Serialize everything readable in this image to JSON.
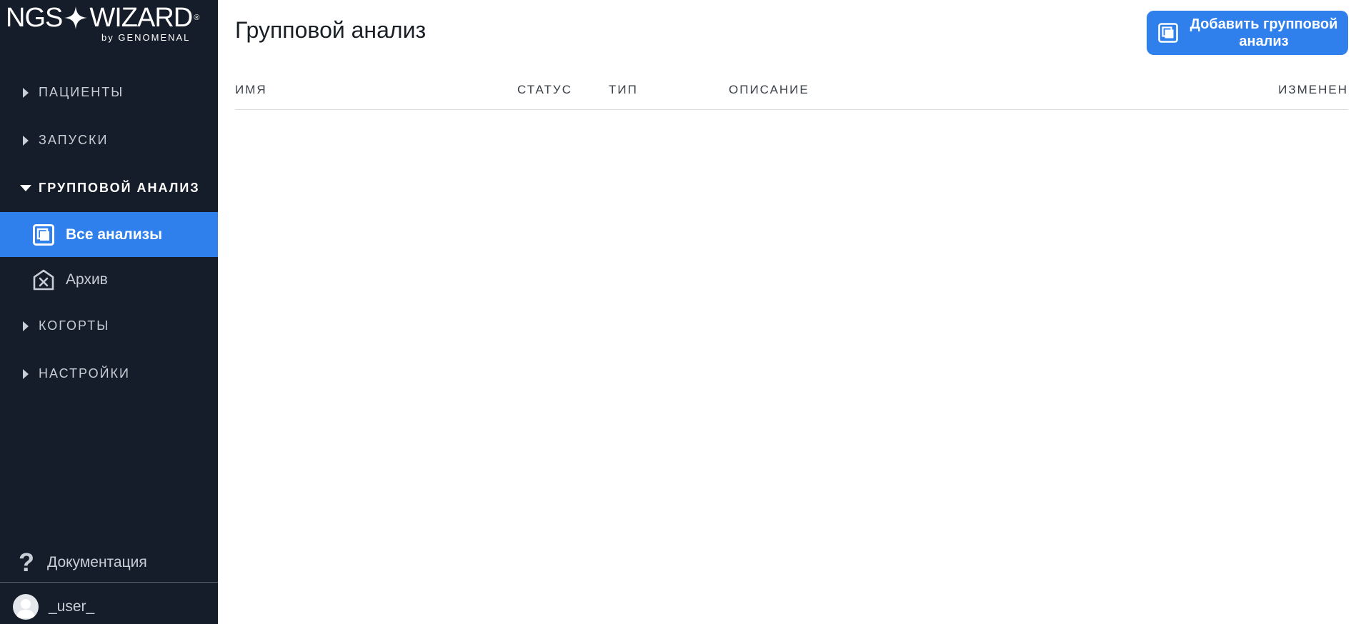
{
  "app": {
    "logo_brand_left": "NGS",
    "logo_brand_right": "WIZARD",
    "logo_registered": "®",
    "logo_by": "by GENOMENAL"
  },
  "sidebar": {
    "groups": [
      {
        "label": "ПАЦИЕНТЫ",
        "open": false
      },
      {
        "label": "ЗАПУСКИ",
        "open": false
      },
      {
        "label": "ГРУППОВОЙ АНАЛИЗ",
        "open": true,
        "items": [
          {
            "label": "Все анализы",
            "icon": "copy-icon",
            "active": true
          },
          {
            "label": "Архив",
            "icon": "archive-icon",
            "active": false
          }
        ]
      },
      {
        "label": "КОГОРТЫ",
        "open": false
      },
      {
        "label": "НАСТРОЙКИ",
        "open": false
      }
    ],
    "docs_label": "Документация",
    "docs_icon": "question-icon",
    "user_label": "_user_",
    "user_icon": "avatar-icon"
  },
  "main": {
    "title": "Групповой анализ",
    "add_button": {
      "label": "Добавить групповой анализ",
      "icon": "copy-icon"
    },
    "table": {
      "columns": [
        "ИМЯ",
        "СТАТУС",
        "ТИП",
        "ОПИСАНИЕ",
        "ИЗМЕНЕН"
      ],
      "rows": []
    }
  },
  "colors": {
    "sidebar_bg": "#141d29",
    "accent": "#2f80ed",
    "text_muted": "#c8ced6",
    "title_text": "#1a1f26"
  }
}
